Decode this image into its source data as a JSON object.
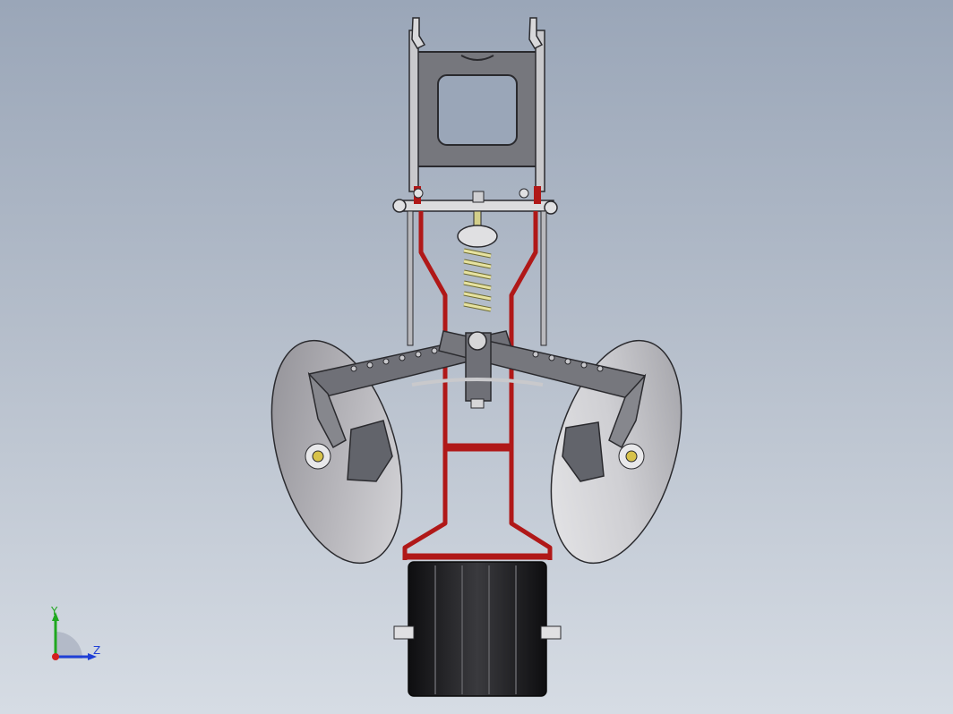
{
  "viewport": {
    "background_top": "#9aa6b8",
    "background_bottom": "#d6dce4"
  },
  "model": {
    "frame_color": "#b01818",
    "steel_color": "#6e7077",
    "disc_color": "#c2c2c6",
    "spring_color": "#d6d28c",
    "wheel_color": "#1c1c1e"
  },
  "triad": {
    "y_label": "Y",
    "z_label": "Z",
    "y_color": "#1fa81f",
    "z_color": "#1f3fd6",
    "x_color": "#d41f1f"
  }
}
